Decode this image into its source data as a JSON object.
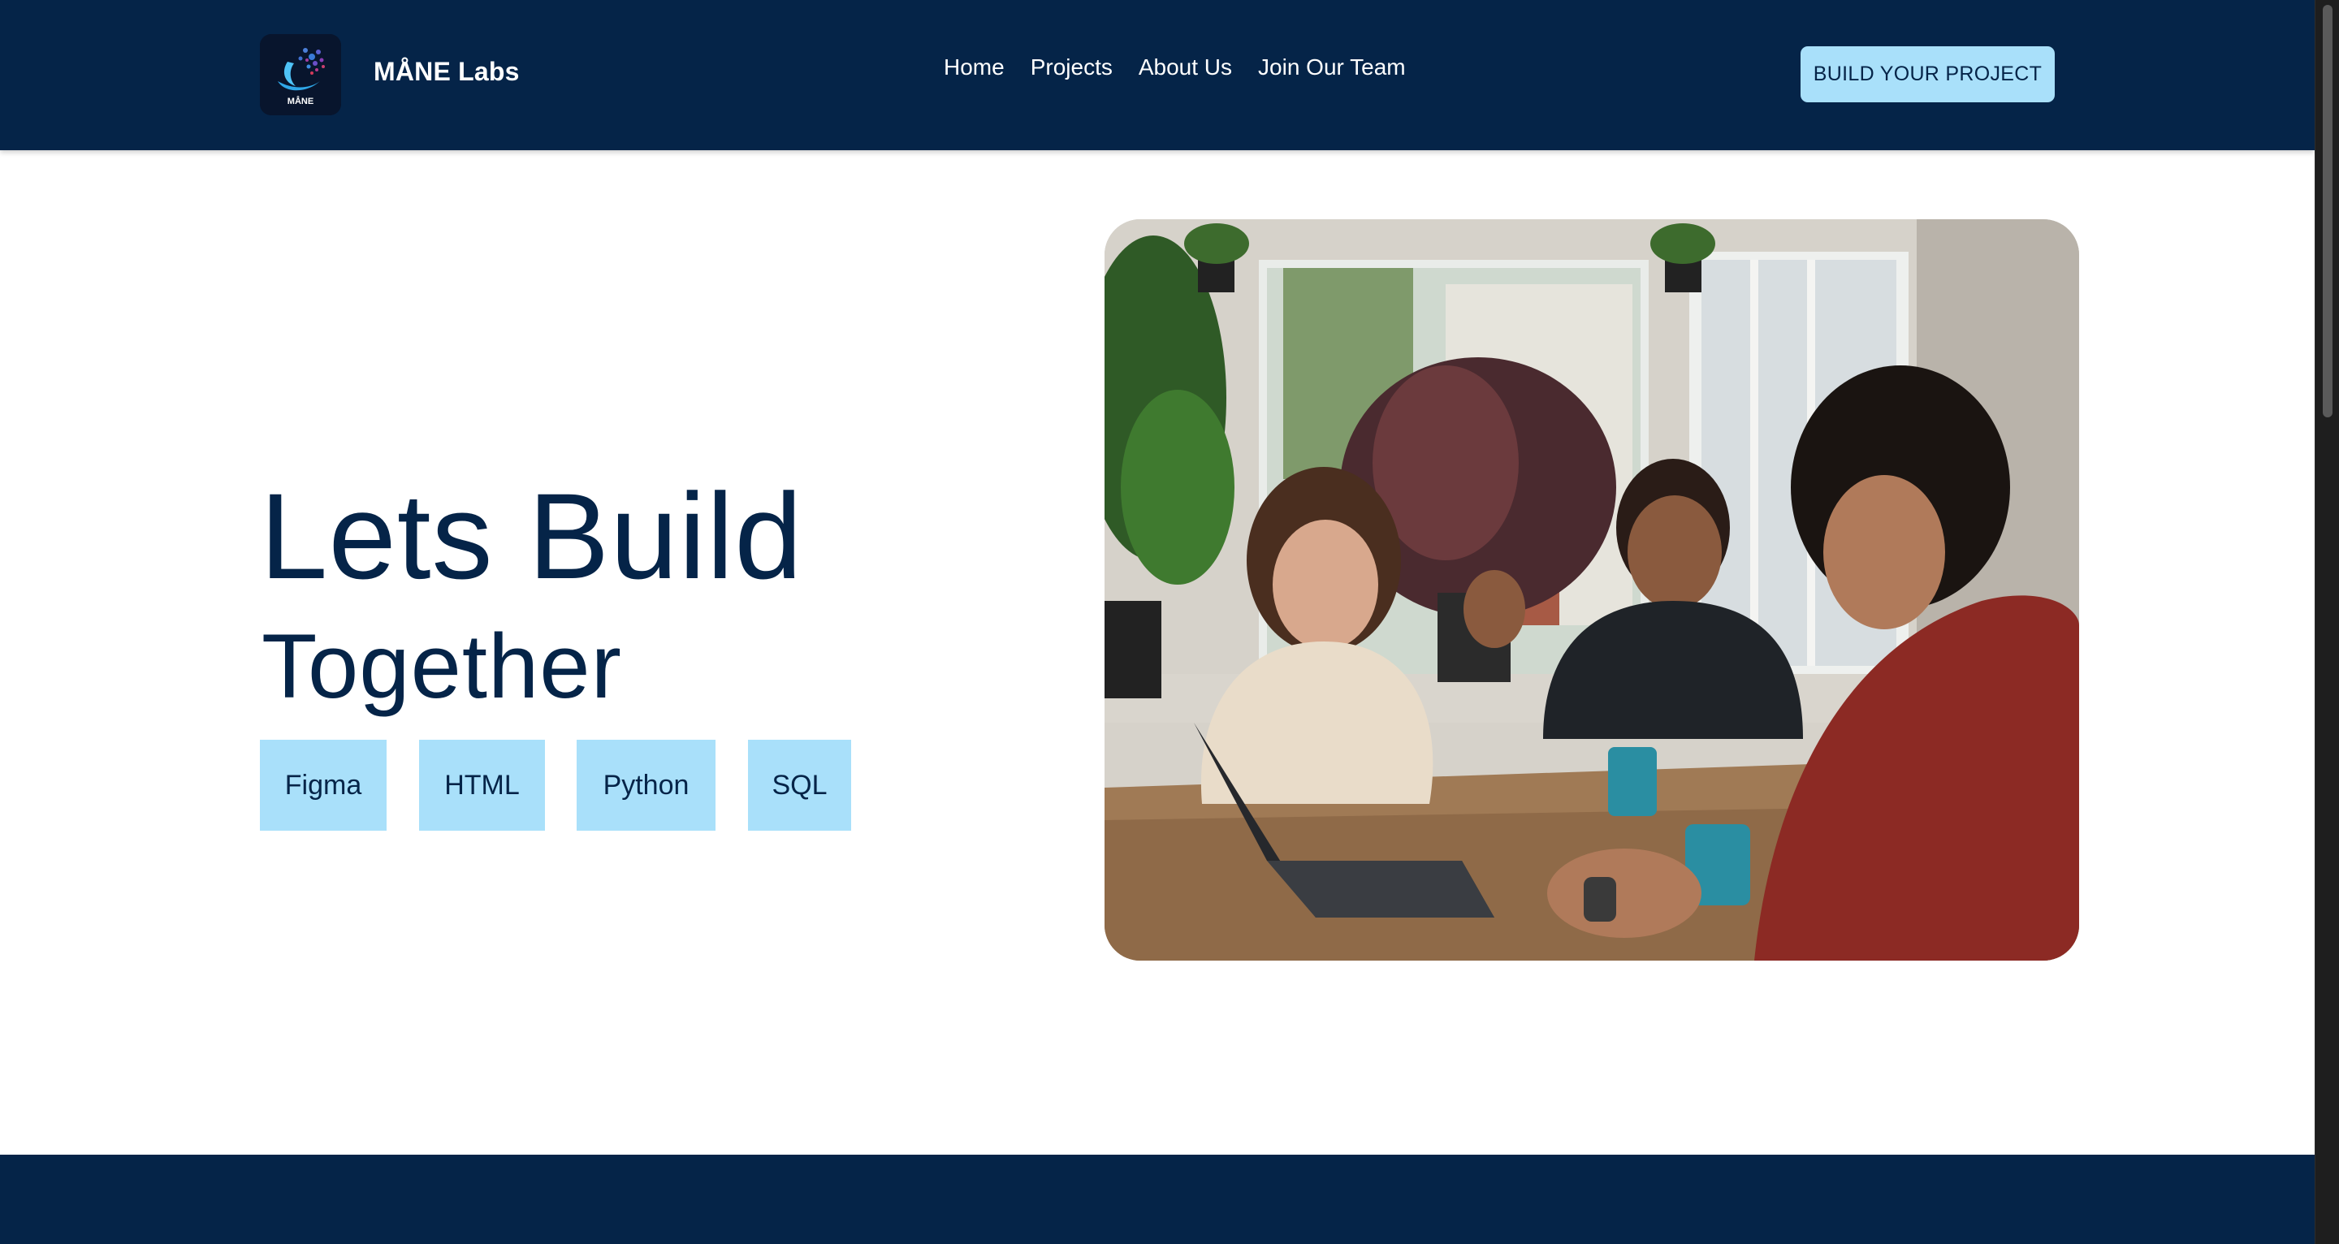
{
  "header": {
    "brand": "MÅNE Labs",
    "logo_text": "MÅNE",
    "nav": [
      "Home",
      "Projects",
      "About Us",
      "Join Our Team"
    ],
    "cta_label": "BUILD YOUR PROJECT"
  },
  "hero": {
    "title": "Lets Build",
    "subtitle": "Together",
    "tags": [
      "Figma",
      "HTML",
      "Python",
      "SQL"
    ]
  },
  "colors": {
    "navy": "#052448",
    "accent": "#A9E0FA",
    "background": "#FFFFFF"
  }
}
